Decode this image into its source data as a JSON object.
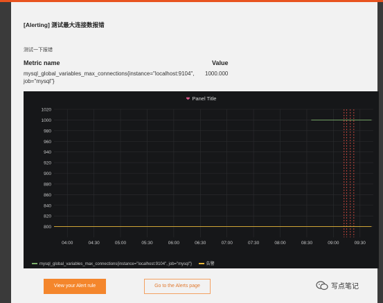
{
  "alert": {
    "title": "[Alerting] 测试最大连接数报错",
    "description": "测试一下报错"
  },
  "metrics_table": {
    "headers": {
      "name": "Metric name",
      "value": "Value"
    },
    "rows": [
      {
        "name": "mysql_global_variables_max_connections{instance=\"localhost:9104\", job=\"mysql\"}",
        "value": "1000.000"
      }
    ]
  },
  "panel": {
    "title": "Panel Title",
    "icon": "broken-heart-icon"
  },
  "chart_data": {
    "type": "line",
    "title": "Panel Title",
    "x_ticks": [
      "04:00",
      "04:30",
      "05:00",
      "05:30",
      "06:00",
      "06:30",
      "07:00",
      "07:30",
      "08:00",
      "08:30",
      "09:00",
      "09:30"
    ],
    "y_ticks": [
      800,
      820,
      840,
      860,
      880,
      900,
      920,
      940,
      960,
      980,
      1000,
      1020
    ],
    "ylim": [
      780,
      1020
    ],
    "xlim": [
      "03:45",
      "09:45"
    ],
    "series": [
      {
        "name": "mysql_global_variables_max_connections{instance=\"localhost:9104\", job=\"mysql\"}",
        "color": "#7eb26d",
        "points": [
          [
            "08:35",
            1000
          ],
          [
            "09:43",
            1000
          ]
        ]
      },
      {
        "name": "告警",
        "color": "#eab839",
        "points": [
          [
            "03:45",
            800
          ],
          [
            "09:43",
            800
          ]
        ]
      }
    ],
    "alert_markers_x": [
      "09:12",
      "09:15",
      "09:19",
      "09:23"
    ],
    "grid": true,
    "legend_position": "bottom-left"
  },
  "buttons": {
    "view_rule": "View your Alert rule",
    "go_alerts": "Go to the Alerts page"
  },
  "watermark": {
    "text": "写点笔记"
  },
  "colors": {
    "accent": "#f4862c",
    "panel_bg": "#161719",
    "alert_marker": "#e24d42"
  }
}
